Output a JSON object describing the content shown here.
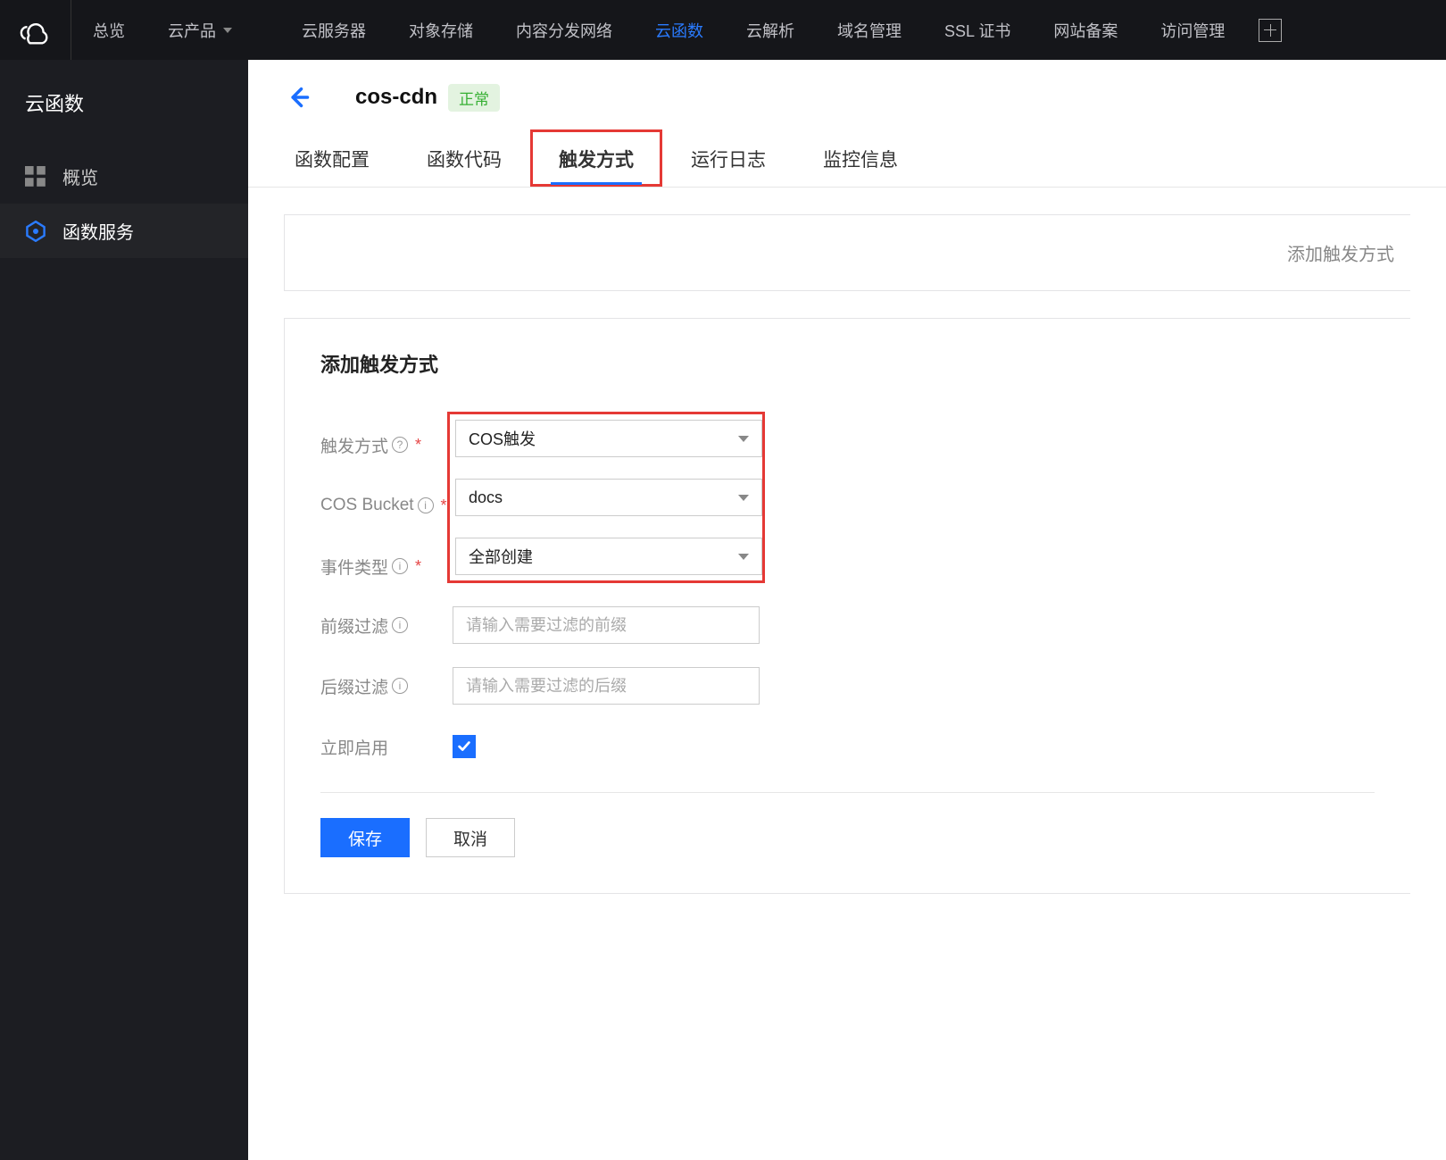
{
  "topnav": {
    "items": [
      {
        "label": "总览"
      },
      {
        "label": "云产品",
        "dropdown": true
      },
      {
        "label": "云服务器"
      },
      {
        "label": "对象存储"
      },
      {
        "label": "内容分发网络"
      },
      {
        "label": "云函数",
        "active": true
      },
      {
        "label": "云解析"
      },
      {
        "label": "域名管理"
      },
      {
        "label": "SSL 证书"
      },
      {
        "label": "网站备案"
      },
      {
        "label": "访问管理"
      }
    ]
  },
  "sidebar": {
    "title": "云函数",
    "items": [
      {
        "label": "概览",
        "icon": "grid"
      },
      {
        "label": "函数服务",
        "icon": "hex",
        "active": true
      }
    ]
  },
  "page": {
    "function_name": "cos-cdn",
    "status_label": "正常",
    "tabs": [
      {
        "label": "函数配置"
      },
      {
        "label": "函数代码"
      },
      {
        "label": "触发方式",
        "active": true,
        "highlight": true
      },
      {
        "label": "运行日志"
      },
      {
        "label": "监控信息"
      }
    ],
    "placeholder_card_text": "添加触发方式"
  },
  "form": {
    "title": "添加触发方式",
    "trigger_type_label": "触发方式",
    "trigger_type_value": "COS触发",
    "bucket_label": "COS Bucket",
    "bucket_value": "docs",
    "event_type_label": "事件类型",
    "event_type_value": "全部创建",
    "prefix_label": "前缀过滤",
    "prefix_placeholder": "请输入需要过滤的前缀",
    "prefix_value": "",
    "suffix_label": "后缀过滤",
    "suffix_placeholder": "请输入需要过滤的后缀",
    "suffix_value": "",
    "enable_label": "立即启用",
    "enable_checked": true,
    "save_label": "保存",
    "cancel_label": "取消"
  }
}
